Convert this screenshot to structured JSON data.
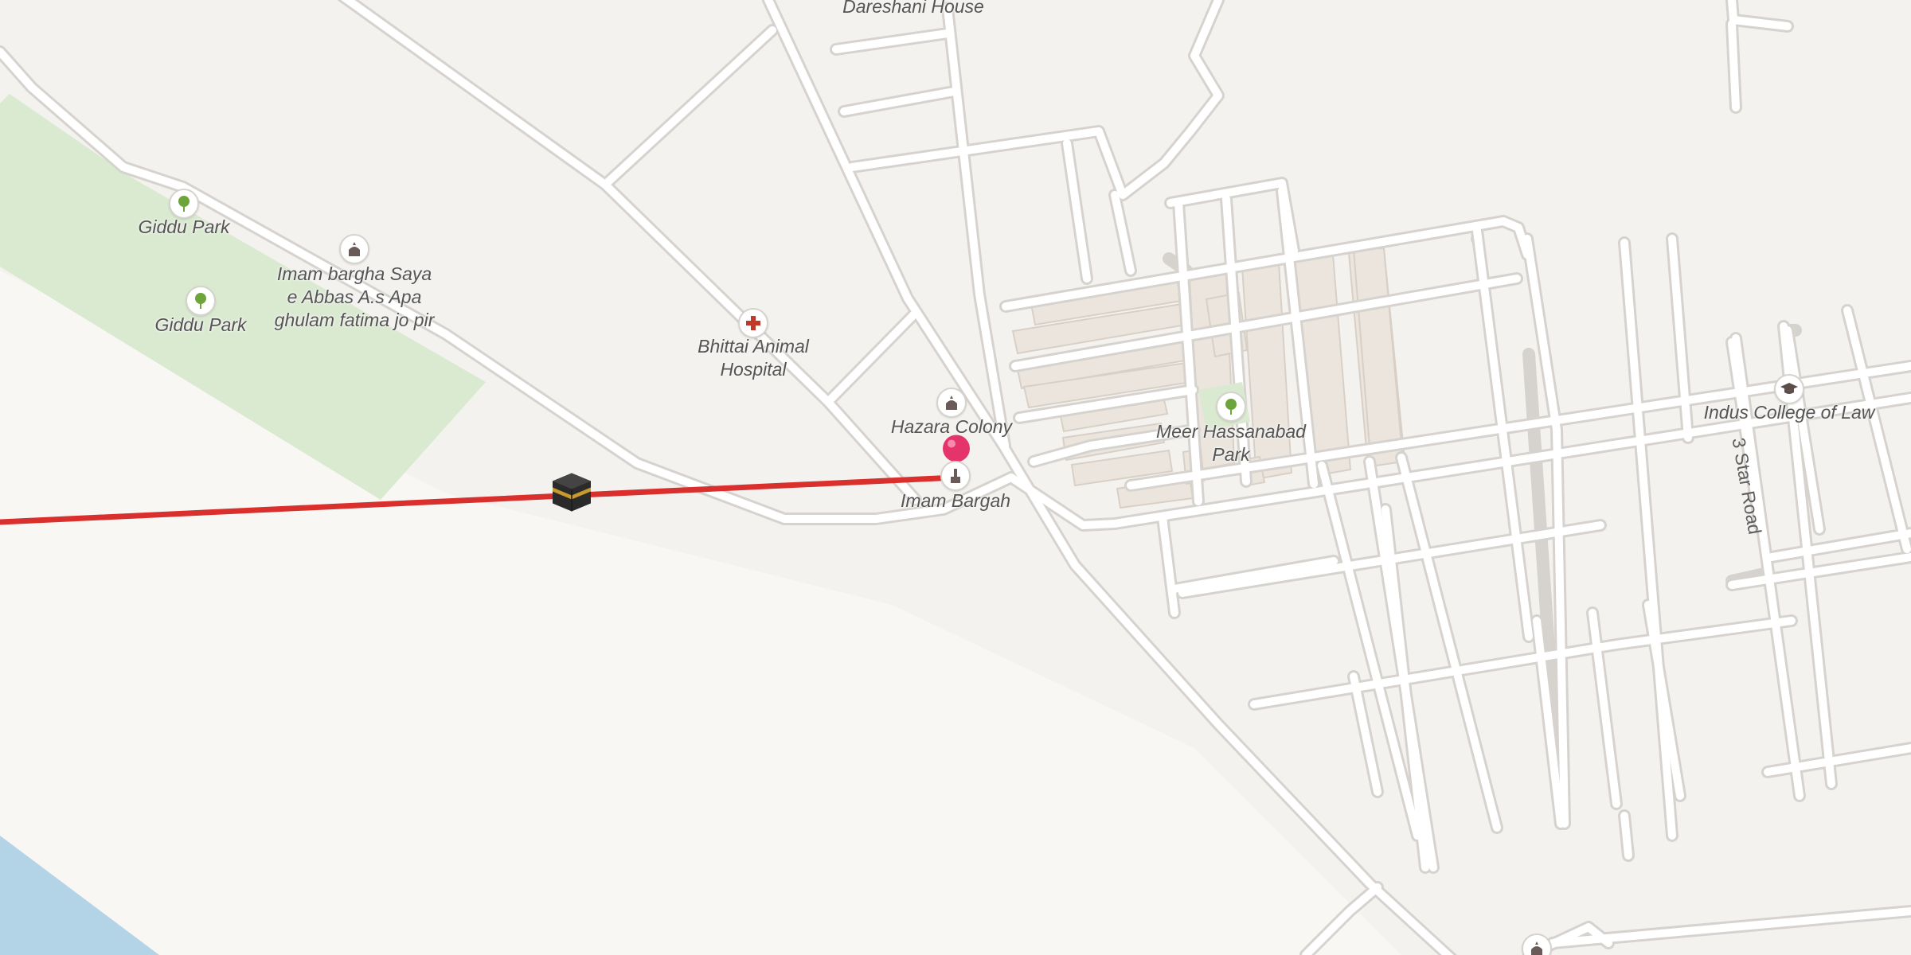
{
  "map": {
    "colors": {
      "land": "#f4f2ef",
      "sand": "#f9f7f3",
      "park": "#d9ead0",
      "water": "#b3d3e6",
      "road_fill": "#ffffff",
      "road_casing": "#d6d3cf",
      "building": "#ebe5de",
      "qibla_line": "#d9302e",
      "pin": "#e5336b"
    },
    "qibla_line": {
      "description_visible": false
    },
    "labels": {
      "dareshani": "Dareshani House",
      "giddu_park_1": "Giddu Park",
      "giddu_park_2": "Giddu Park",
      "imam_bargha_line1": "Imam bargha Saya",
      "imam_bargha_line2": "e Abbas A.s Apa",
      "imam_bargha_line3": "ghulam fatima jo pir",
      "bhittai_line1": "Bhittai Animal",
      "bhittai_line2": "Hospital",
      "hazara": "Hazara Colony",
      "imam_bargah": "Imam Bargah",
      "meer_line1": "Meer Hassanabad",
      "meer_line2": "Park",
      "indus": "Indus College of Law",
      "star_road": "3 Star Road"
    },
    "icons": {
      "park": "tree-icon",
      "mosque": "mosque-icon",
      "hospital": "hospital-cross-icon",
      "college": "graduation-cap-icon",
      "current_location": "location-pin-icon",
      "kaaba": "kaaba-icon"
    }
  }
}
